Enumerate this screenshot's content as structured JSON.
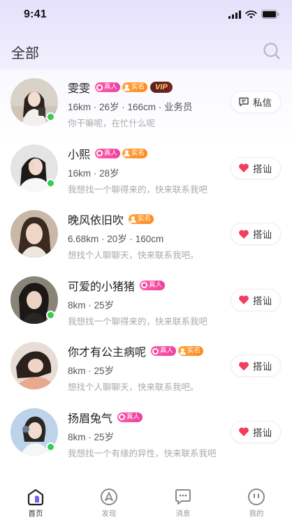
{
  "status_bar": {
    "time": "9:41"
  },
  "header": {
    "title": "全部"
  },
  "users": [
    {
      "name": "雯雯",
      "badges": [
        "real",
        "name",
        "vip"
      ],
      "stats": "16km · 26岁 · 166cm · 业务员",
      "bio": "你干嘛呢，在忙什么呢",
      "online": true,
      "action": "私信",
      "action_icon": "message-icon"
    },
    {
      "name": "小熙",
      "badges": [
        "real",
        "name"
      ],
      "stats": "16km · 28岁",
      "bio": "我想找一个聊得来的，快来联系我吧",
      "online": true,
      "action": "搭讪",
      "action_icon": "heart-icon"
    },
    {
      "name": "晚风依旧吹",
      "badges": [
        "name"
      ],
      "stats": "6.68km · 20岁 · 160cm",
      "bio": "想找个人聊聊天，快来联系我吧。",
      "online": false,
      "action": "搭讪",
      "action_icon": "heart-icon"
    },
    {
      "name": "可爱的小猪猪",
      "badges": [
        "real"
      ],
      "stats": "8km · 25岁",
      "bio": "我想找一个聊得来的，快来联系我吧",
      "online": true,
      "action": "搭讪",
      "action_icon": "heart-icon"
    },
    {
      "name": "你才有公主病呢",
      "badges": [
        "real",
        "name"
      ],
      "stats": "8km · 25岁",
      "bio": "想找个人聊聊天，快来联系我吧。",
      "online": false,
      "action": "搭讪",
      "action_icon": "heart-icon"
    },
    {
      "name": "扬眉兔气",
      "badges": [
        "real"
      ],
      "stats": "8km · 25岁",
      "bio": "我想找一个有缘的异性，快来联系我吧",
      "online": true,
      "action": "搭讪",
      "action_icon": "heart-icon"
    }
  ],
  "badge_labels": {
    "real": "真人",
    "name": "实名",
    "vip": "VIP"
  },
  "tabs": [
    {
      "label": "首页",
      "icon": "home-icon",
      "active": true
    },
    {
      "label": "发现",
      "icon": "compass-icon",
      "active": false
    },
    {
      "label": "消息",
      "icon": "chat-icon",
      "active": false
    },
    {
      "label": "我的",
      "icon": "profile-icon",
      "active": false
    }
  ],
  "colors": {
    "accent": "#7b5cf0",
    "heart": "#f23d5c",
    "badge_real": "#f03ea0",
    "badge_name": "#ff8a1f",
    "online": "#33cc55"
  }
}
